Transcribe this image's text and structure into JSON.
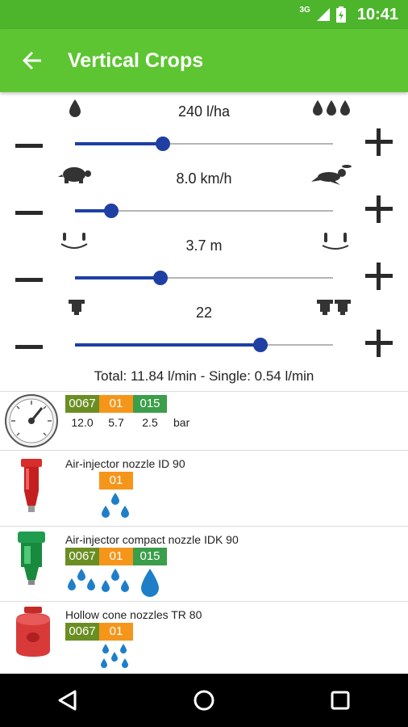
{
  "status_bar": {
    "network": "3G",
    "time": "10:41"
  },
  "app_bar": {
    "title": "Vertical Crops",
    "back_icon": "arrow-back-icon"
  },
  "controls": [
    {
      "id": "volume",
      "value_text": "240 l/ha",
      "level": 0.34,
      "left_icon": "single-drop-icon",
      "right_icon": "triple-drop-icon"
    },
    {
      "id": "speed",
      "value_text": "8.0 km/h",
      "level": 0.14,
      "left_icon": "turtle-icon",
      "right_icon": "rabbit-icon"
    },
    {
      "id": "spacing",
      "value_text": "3.7 m",
      "level": 0.33,
      "left_icon": "narrow-rows-icon",
      "right_icon": "wide-rows-icon"
    },
    {
      "id": "nozzles",
      "value_text": "22",
      "level": 0.72,
      "left_icon": "single-nozzle-icon",
      "right_icon": "double-nozzle-icon"
    }
  ],
  "total_text": "Total: 11.84 l/min - Single: 0.54 l/min",
  "pressure_row": {
    "tags": [
      {
        "label": "0067",
        "color": "#6b8e23"
      },
      {
        "label": "01",
        "color": "#f5961b"
      },
      {
        "label": "015",
        "color": "#3b9e4a"
      }
    ],
    "values": [
      "12.0",
      "5.7",
      "2.5"
    ],
    "unit": "bar"
  },
  "nozzle_rows": [
    {
      "name": "Air-injector nozzle ID 90",
      "tags": [
        {
          "label": "01",
          "color": "#f5961b"
        }
      ],
      "image": "red-nozzle-icon"
    },
    {
      "name": "Air-injector compact nozzle IDK 90",
      "tags": [
        {
          "label": "0067",
          "color": "#6b8e23"
        },
        {
          "label": "01",
          "color": "#f5961b"
        },
        {
          "label": "015",
          "color": "#3b9e4a"
        }
      ],
      "image": "green-nozzle-icon"
    },
    {
      "name": "Hollow cone nozzles TR 80",
      "tags": [
        {
          "label": "0067",
          "color": "#6b8e23"
        },
        {
          "label": "01",
          "color": "#f5961b"
        }
      ],
      "image": "red-cone-nozzle-icon"
    }
  ],
  "nav_bar": {
    "back": "nav-back-icon",
    "home": "nav-home-icon",
    "recents": "nav-recents-icon"
  }
}
